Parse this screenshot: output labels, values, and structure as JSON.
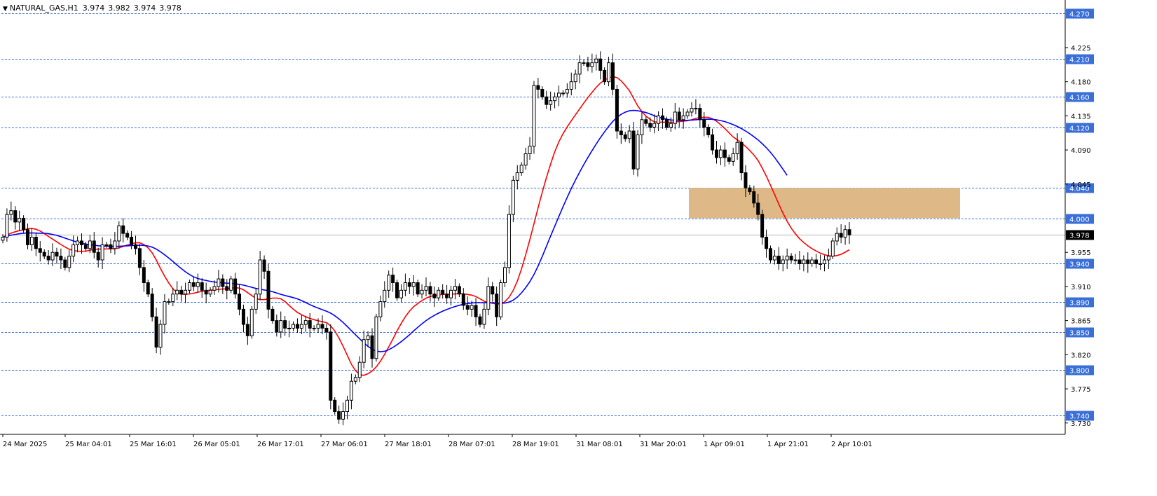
{
  "header": {
    "symbol": "NATURAL_GAS,H1",
    "open": "3.974",
    "high": "3.982",
    "low": "3.974",
    "close": "3.978"
  },
  "colors": {
    "background": "#ffffff",
    "axis": "#000000",
    "level_line": "#3a6fd8",
    "level_label_bg": "#3a6fd8",
    "current_price_bg": "#000000",
    "current_price_line": "#b4b4b4",
    "ma_fast": "#ff0000",
    "ma_slow": "#0000ff",
    "zone_fill": "#deb887",
    "bull_candle": "#ffffff",
    "bear_candle": "#000000"
  },
  "chart_data": {
    "type": "candlestick",
    "instrument": "NATURAL_GAS",
    "timeframe": "H1",
    "ylim": [
      3.715,
      4.285
    ],
    "price_axis_ticks": [
      "4.225",
      "4.180",
      "4.135",
      "4.090",
      "4.045",
      "3.955",
      "3.910",
      "3.865",
      "3.820",
      "3.775",
      "3.730"
    ],
    "time_axis_labels": [
      "24 Mar 2025",
      "25 Mar 04:01",
      "25 Mar 16:01",
      "26 Mar 05:01",
      "26 Mar 17:01",
      "27 Mar 06:01",
      "27 Mar 18:01",
      "28 Mar 07:01",
      "28 Mar 19:01",
      "31 Mar 08:01",
      "31 Mar 20:01",
      "1 Apr 09:01",
      "1 Apr 21:01",
      "2 Apr 10:01"
    ],
    "horizontal_levels": [
      "4.270",
      "4.210",
      "4.160",
      "4.120",
      "4.040",
      "4.000",
      "3.940",
      "3.890",
      "3.850",
      "3.800",
      "3.740"
    ],
    "current_price": "3.978",
    "zone": {
      "top": 4.04,
      "bottom": 4.0
    },
    "candles_close": [
      3.975,
      4.005,
      4.01,
      3.995,
      4.0,
      3.985,
      3.965,
      3.975,
      3.96,
      3.955,
      3.95,
      3.945,
      3.955,
      3.95,
      3.945,
      3.935,
      3.95,
      3.965,
      3.97,
      3.965,
      3.96,
      3.97,
      3.955,
      3.945,
      3.965,
      3.965,
      3.96,
      3.97,
      3.99,
      3.98,
      3.975,
      3.965,
      3.96,
      3.935,
      3.915,
      3.9,
      3.87,
      3.83,
      3.86,
      3.89,
      3.89,
      3.9,
      3.905,
      3.9,
      3.905,
      3.915,
      3.91,
      3.915,
      3.905,
      3.9,
      3.905,
      3.91,
      3.92,
      3.91,
      3.905,
      3.92,
      3.9,
      3.88,
      3.86,
      3.845,
      3.88,
      3.9,
      3.945,
      3.93,
      3.88,
      3.865,
      3.85,
      3.865,
      3.855,
      3.855,
      3.86,
      3.855,
      3.86,
      3.865,
      3.855,
      3.855,
      3.86,
      3.855,
      3.85,
      3.76,
      3.745,
      3.735,
      3.745,
      3.76,
      3.785,
      3.79,
      3.81,
      3.84,
      3.845,
      3.815,
      3.87,
      3.89,
      3.905,
      3.925,
      3.915,
      3.895,
      3.905,
      3.915,
      3.91,
      3.915,
      3.9,
      3.905,
      3.91,
      3.9,
      3.895,
      3.905,
      3.9,
      3.895,
      3.905,
      3.91,
      3.9,
      3.885,
      3.88,
      3.885,
      3.87,
      3.86,
      3.88,
      3.91,
      3.9,
      3.87,
      3.915,
      3.935,
      4.005,
      4.05,
      4.06,
      4.07,
      4.085,
      4.095,
      4.175,
      4.17,
      4.16,
      4.15,
      4.155,
      4.16,
      4.165,
      4.165,
      4.17,
      4.18,
      4.19,
      4.205,
      4.205,
      4.2,
      4.205,
      4.21,
      4.195,
      4.18,
      4.205,
      4.17,
      4.115,
      4.11,
      4.105,
      4.115,
      4.065,
      4.11,
      4.13,
      4.125,
      4.12,
      4.125,
      4.135,
      4.13,
      4.12,
      4.125,
      4.14,
      4.13,
      4.135,
      4.14,
      4.145,
      4.145,
      4.13,
      4.12,
      4.11,
      4.09,
      4.08,
      4.09,
      4.08,
      4.075,
      4.085,
      4.1,
      4.06,
      4.04,
      4.035,
      4.02,
      4.005,
      3.975,
      3.96,
      3.945,
      3.95,
      3.94,
      3.945,
      3.95,
      3.945,
      3.945,
      3.94,
      3.945,
      3.94,
      3.945,
      3.94,
      3.94,
      3.945,
      3.95,
      3.97,
      3.98,
      3.975,
      3.985,
      3.978
    ]
  }
}
